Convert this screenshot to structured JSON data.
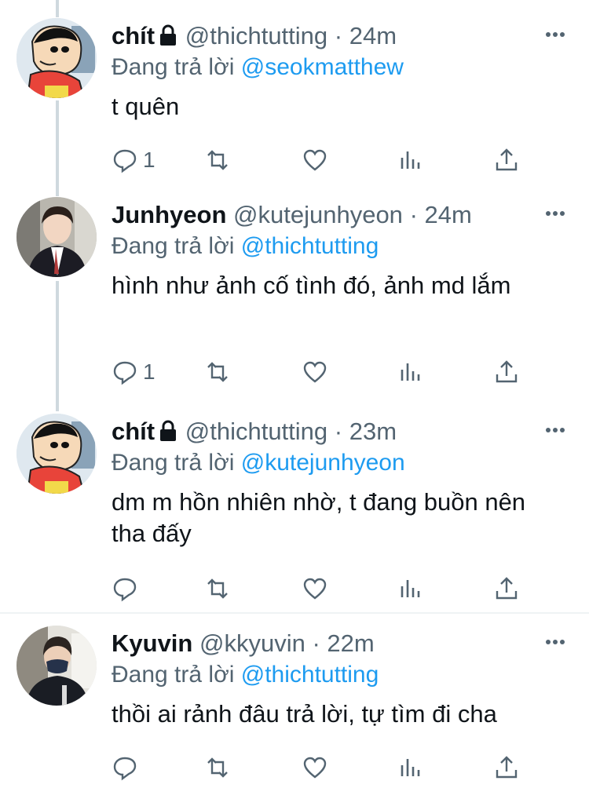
{
  "tweets": [
    {
      "name": "chít",
      "locked": true,
      "handle": "@thichtutting",
      "dot": "·",
      "time": "24m",
      "replying_prefix": "Đang trả lời ",
      "replying_to": "@seokmatthew",
      "text": "t quên",
      "reply_count": "1"
    },
    {
      "name": "Junhyeon",
      "locked": false,
      "handle": "@kutejunhyeon",
      "dot": "·",
      "time": "24m",
      "replying_prefix": "Đang trả lời ",
      "replying_to": "@thichtutting",
      "text": "hình như ảnh cố tình đó, ảnh md lắm",
      "reply_count": "1"
    },
    {
      "name": "chít",
      "locked": true,
      "handle": "@thichtutting",
      "dot": "·",
      "time": "23m",
      "replying_prefix": "Đang trả lời ",
      "replying_to": "@kutejunhyeon",
      "text": "dm m hồn nhiên nhờ, t đang buồn nên tha đấy",
      "reply_count": ""
    },
    {
      "name": "Kyuvin",
      "locked": false,
      "handle": "@kkyuvin",
      "dot": "·",
      "time": "22m",
      "replying_prefix": "Đang trả lời ",
      "replying_to": "@thichtutting",
      "text": "thồi ai rảnh đâu trả lời, tự tìm đi cha",
      "reply_count": ""
    }
  ],
  "colors": {
    "accent": "#1d9bf0",
    "secondary_text": "#536471",
    "thread_line": "#cfd9de"
  }
}
